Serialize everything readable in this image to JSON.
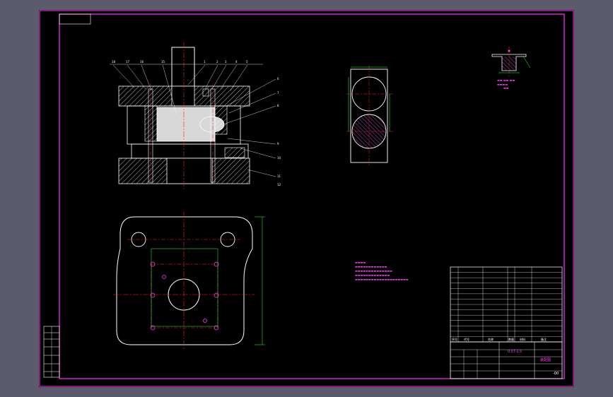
{
  "colors": {
    "background": "#5b5b6b",
    "drawing_area": "#000000",
    "frame": "#ff33ff",
    "outline": "#ffffff",
    "centerline": "#ff2222",
    "dimension": "#33ff33",
    "annotation": "#ff44ff"
  },
  "drawing": {
    "title_block_code": "-00",
    "title_block_name": "0.5T-1.5",
    "title_block_assembly": "装配图",
    "section_balloons": [
      "18",
      "17",
      "16",
      "15",
      "1",
      "2",
      "3",
      "4",
      "5",
      "6",
      "7",
      "8",
      "9",
      "10",
      "11",
      "12"
    ],
    "parts_list_header": [
      "序号",
      "代号",
      "名称",
      "数量",
      "材料",
      "备注"
    ]
  },
  "icons": {
    "cut_plane_symbol": "hatched-circle-icon",
    "roughness_symbol": "surface-finish-icon"
  }
}
